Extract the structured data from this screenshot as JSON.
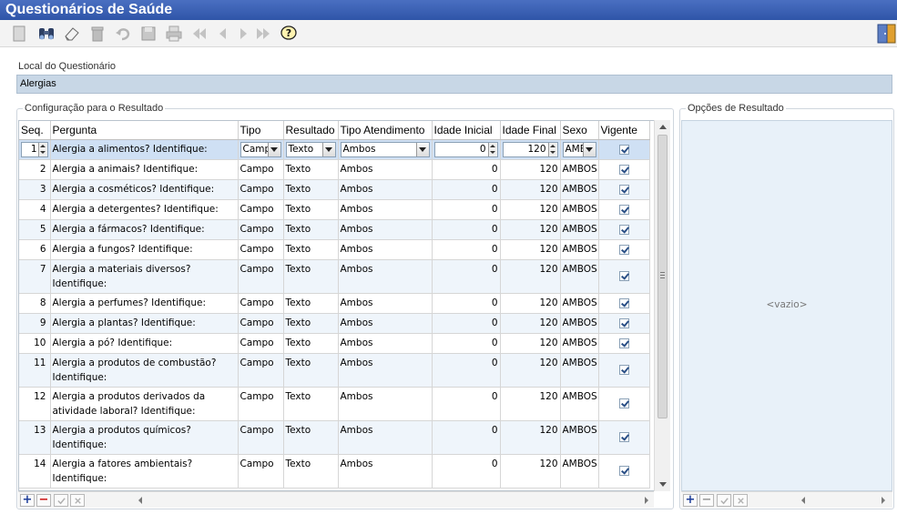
{
  "window": {
    "title": "Questionários de Saúde"
  },
  "toolbar": {
    "buttons": [
      {
        "name": "new-button",
        "icon": "blank-document-icon"
      },
      {
        "name": "search-button",
        "icon": "binoculars-icon"
      },
      {
        "name": "clear-button",
        "icon": "eraser-icon"
      },
      {
        "name": "delete-button",
        "icon": "trash-icon"
      },
      {
        "name": "undo-button",
        "icon": "undo-icon"
      },
      {
        "name": "save-button",
        "icon": "floppy-icon"
      },
      {
        "name": "print-button",
        "icon": "printer-icon"
      },
      {
        "name": "first-button",
        "icon": "double-left-icon"
      },
      {
        "name": "previous-button",
        "icon": "left-icon"
      },
      {
        "name": "next-button",
        "icon": "right-icon"
      },
      {
        "name": "last-button",
        "icon": "double-right-icon"
      },
      {
        "name": "help-button",
        "icon": "help-bubble-icon"
      }
    ],
    "exit_icon": "exit-door-icon"
  },
  "local": {
    "label": "Local do Questionário",
    "value": "Alergias"
  },
  "config": {
    "legend": "Configuração para o Resultado",
    "columns": [
      "Seq.",
      "Pergunta",
      "Tipo",
      "Resultado",
      "Tipo Atendimento",
      "Idade Inicial",
      "Idade Final",
      "Sexo",
      "Vigente"
    ],
    "rows": [
      {
        "seq": "1",
        "pergunta": "Alergia a alimentos? Identifique:",
        "tipo": "Campo",
        "resultado": "Texto",
        "atendimento": "Ambos",
        "idade_ini": "0",
        "idade_fim": "120",
        "sexo": "AMBOS",
        "vigente": true
      },
      {
        "seq": "2",
        "pergunta": "Alergia a animais? Identifique:",
        "tipo": "Campo",
        "resultado": "Texto",
        "atendimento": "Ambos",
        "idade_ini": "0",
        "idade_fim": "120",
        "sexo": "AMBOS",
        "vigente": true
      },
      {
        "seq": "3",
        "pergunta": "Alergia a cosméticos? Identifique:",
        "tipo": "Campo",
        "resultado": "Texto",
        "atendimento": "Ambos",
        "idade_ini": "0",
        "idade_fim": "120",
        "sexo": "AMBOS",
        "vigente": true
      },
      {
        "seq": "4",
        "pergunta": "Alergia a detergentes? Identifique:",
        "tipo": "Campo",
        "resultado": "Texto",
        "atendimento": "Ambos",
        "idade_ini": "0",
        "idade_fim": "120",
        "sexo": "AMBOS",
        "vigente": true
      },
      {
        "seq": "5",
        "pergunta": "Alergia a fármacos? Identifique:",
        "tipo": "Campo",
        "resultado": "Texto",
        "atendimento": "Ambos",
        "idade_ini": "0",
        "idade_fim": "120",
        "sexo": "AMBOS",
        "vigente": true
      },
      {
        "seq": "6",
        "pergunta": "Alergia a fungos? Identifique:",
        "tipo": "Campo",
        "resultado": "Texto",
        "atendimento": "Ambos",
        "idade_ini": "0",
        "idade_fim": "120",
        "sexo": "AMBOS",
        "vigente": true
      },
      {
        "seq": "7",
        "pergunta": "Alergia a materiais diversos? Identifique:",
        "tipo": "Campo",
        "resultado": "Texto",
        "atendimento": "Ambos",
        "idade_ini": "0",
        "idade_fim": "120",
        "sexo": "AMBOS",
        "vigente": true
      },
      {
        "seq": "8",
        "pergunta": "Alergia a perfumes? Identifique:",
        "tipo": "Campo",
        "resultado": "Texto",
        "atendimento": "Ambos",
        "idade_ini": "0",
        "idade_fim": "120",
        "sexo": "AMBOS",
        "vigente": true
      },
      {
        "seq": "9",
        "pergunta": "Alergia a plantas? Identifique:",
        "tipo": "Campo",
        "resultado": "Texto",
        "atendimento": "Ambos",
        "idade_ini": "0",
        "idade_fim": "120",
        "sexo": "AMBOS",
        "vigente": true
      },
      {
        "seq": "10",
        "pergunta": "Alergia a pó? Identifique:",
        "tipo": "Campo",
        "resultado": "Texto",
        "atendimento": "Ambos",
        "idade_ini": "0",
        "idade_fim": "120",
        "sexo": "AMBOS",
        "vigente": true
      },
      {
        "seq": "11",
        "pergunta": "Alergia a produtos de combustão? Identifique:",
        "tipo": "Campo",
        "resultado": "Texto",
        "atendimento": "Ambos",
        "idade_ini": "0",
        "idade_fim": "120",
        "sexo": "AMBOS",
        "vigente": true
      },
      {
        "seq": "12",
        "pergunta": "Alergia a produtos derivados da atividade laboral? Identifique:",
        "tipo": "Campo",
        "resultado": "Texto",
        "atendimento": "Ambos",
        "idade_ini": "0",
        "idade_fim": "120",
        "sexo": "AMBOS",
        "vigente": true
      },
      {
        "seq": "13",
        "pergunta": "Alergia a produtos químicos? Identifique:",
        "tipo": "Campo",
        "resultado": "Texto",
        "atendimento": "Ambos",
        "idade_ini": "0",
        "idade_fim": "120",
        "sexo": "AMBOS",
        "vigente": true
      },
      {
        "seq": "14",
        "pergunta": "Alergia a fatores ambientais? Identifique:",
        "tipo": "Campo",
        "resultado": "Texto",
        "atendimento": "Ambos",
        "idade_ini": "0",
        "idade_fim": "120",
        "sexo": "AMBOS",
        "vigente": true
      }
    ],
    "selected_row": 0,
    "edit_row": {
      "tipo": "Camp",
      "sexo": "AMB"
    }
  },
  "options": {
    "legend": "Opções de Resultado",
    "empty_text": "<vazio>"
  },
  "bottombar": {
    "add": "+",
    "remove": "−"
  },
  "colors": {
    "title_bar": "#3a60b4",
    "local_field_bg": "#c8d7e6",
    "row_alt": "#eff5fb",
    "row_selected": "#cfe0f4",
    "empty_panel": "#e8f1f9"
  }
}
